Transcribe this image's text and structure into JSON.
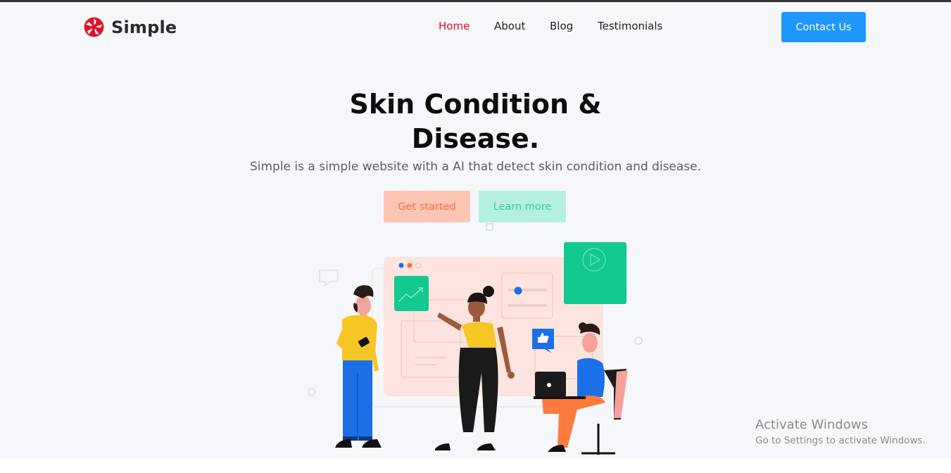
{
  "brand": {
    "name": "Simple",
    "icon": "aperture-logo-icon",
    "color": "#e3102a"
  },
  "nav": {
    "items": [
      {
        "label": "Home",
        "active": true
      },
      {
        "label": "About",
        "active": false
      },
      {
        "label": "Blog",
        "active": false
      },
      {
        "label": "Testimonials",
        "active": false
      }
    ],
    "cta_label": "Contact Us"
  },
  "hero": {
    "title_line1": "Skin Condition &",
    "title_line2": "Disease.",
    "subtitle": "Simple is a simple website with a AI that detect skin condition and disease.",
    "primary_button": "Get started",
    "secondary_button": "Learn more",
    "illustration": "team-collaboration-illustration"
  },
  "os_overlay": {
    "title": "Activate Windows",
    "subtitle": "Go to Settings to activate Windows."
  },
  "colors": {
    "accent": "#1e97ff",
    "brand_red": "#e3102a",
    "primary_btn_bg": "#fdc6b4",
    "primary_btn_text": "#ff6a3d",
    "secondary_btn_bg": "#b5efde",
    "secondary_btn_text": "#35cf9b",
    "illustration_green": "#12c98f"
  }
}
